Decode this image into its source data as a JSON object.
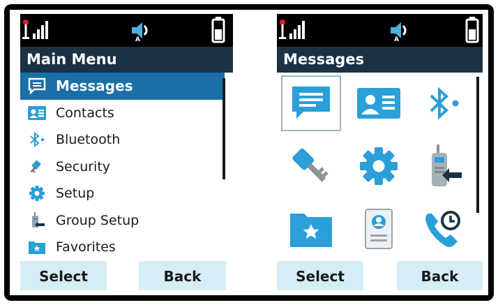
{
  "left_screen": {
    "title": "Main Menu",
    "menu_items": [
      {
        "label": "Messages",
        "icon": "message-icon",
        "selected": true
      },
      {
        "label": "Contacts",
        "icon": "contact-card-icon",
        "selected": false
      },
      {
        "label": "Bluetooth",
        "icon": "bluetooth-icon",
        "selected": false
      },
      {
        "label": "Security",
        "icon": "key-icon",
        "selected": false
      },
      {
        "label": "Setup",
        "icon": "gear-icon",
        "selected": false
      },
      {
        "label": "Group Setup",
        "icon": "radio-group-icon",
        "selected": false
      },
      {
        "label": "Favorites",
        "icon": "favorites-folder-icon",
        "selected": false
      }
    ],
    "softkeys": {
      "left": "Select",
      "right": "Back"
    }
  },
  "right_screen": {
    "title": "Messages",
    "grid_icons": [
      "message-icon",
      "contact-card-icon",
      "bluetooth-icon",
      "key-icon",
      "gear-icon",
      "radio-group-icon",
      "favorites-folder-icon",
      "profile-document-icon",
      "recent-calls-icon"
    ],
    "softkeys": {
      "left": "Select",
      "right": "Back"
    }
  },
  "status_bar": {
    "signal": "signal-strength-icon",
    "audio": "talkaround-speaker-icon",
    "battery": "battery-icon"
  },
  "colors": {
    "accent": "#1a6fa8",
    "icon_blue": "#2a9fd8",
    "title_bg": "#1b3245",
    "softkey_bg": "#d5edf5"
  }
}
